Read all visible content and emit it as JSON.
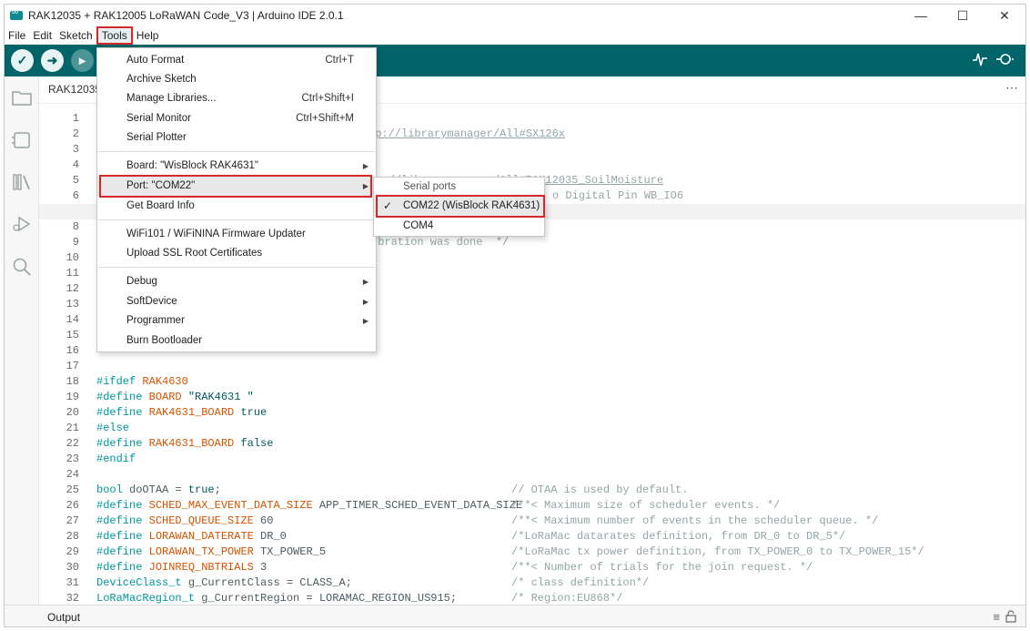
{
  "window": {
    "title": "RAK12035 + RAK12005 LoRaWAN Code_V3 | Arduino IDE 2.0.1",
    "controls": [
      "—",
      "☐",
      "✕"
    ]
  },
  "menubar": [
    "File",
    "Edit",
    "Sketch",
    "Tools",
    "Help"
  ],
  "toolbar": {
    "verify_icon": "check-icon",
    "upload_icon": "arrow-right-icon",
    "debug_icon": "debug-icon",
    "serial_plotter_icon": "plotter-icon",
    "serial_monitor_icon": "monitor-icon"
  },
  "tab": {
    "label": "RAK12035",
    "more": "⋯"
  },
  "tools_menu": {
    "items": [
      {
        "label": "Auto Format",
        "shortcut": "Ctrl+T"
      },
      {
        "label": "Archive Sketch",
        "shortcut": ""
      },
      {
        "label": "Manage Libraries...",
        "shortcut": "Ctrl+Shift+I"
      },
      {
        "label": "Serial Monitor",
        "shortcut": "Ctrl+Shift+M"
      },
      {
        "label": "Serial Plotter",
        "shortcut": ""
      },
      {
        "label": "Board: \"WisBlock RAK4631\"",
        "shortcut": ""
      },
      {
        "label": "Port: \"COM22\"",
        "shortcut": ""
      },
      {
        "label": "Get Board Info",
        "shortcut": ""
      },
      {
        "label": "WiFi101 / WiFiNINA Firmware Updater",
        "shortcut": ""
      },
      {
        "label": "Upload SSL Root Certificates",
        "shortcut": ""
      },
      {
        "label": "Debug",
        "shortcut": ""
      },
      {
        "label": "SoftDevice",
        "shortcut": ""
      },
      {
        "label": "Programmer",
        "shortcut": ""
      },
      {
        "label": "Burn Bootloader",
        "shortcut": ""
      }
    ]
  },
  "port_submenu": {
    "header": "Serial ports",
    "items": [
      {
        "label": "COM22 (WisBlock RAK4631)",
        "check": "✓"
      },
      {
        "label": "COM4",
        "check": ""
      }
    ]
  },
  "editor": {
    "line_numbers": [
      "1",
      "2",
      "3",
      "4",
      "5",
      "6",
      "7",
      "8",
      "9",
      "10",
      "11",
      "12",
      "13",
      "14",
      "15",
      "16",
      "17",
      "18",
      "19",
      "20",
      "21",
      "22",
      "23",
      "24",
      "25",
      "26",
      "27",
      "28",
      "29",
      "30",
      "31",
      "32"
    ],
    "visible_fragments": {
      "l2": "tp://librarymanager/All#SX126x",
      "l5": "tp://librarymanager/All#RAK12035_SoilMoisture",
      "l6": "o Digital Pin WB_IO6",
      "l9": "ibration was done  */"
    },
    "code": {
      "l18a": "#ifdef",
      "l18b": " RAK4630",
      "l19a": "#define",
      "l19b": "BOARD",
      "l19c": "\"RAK4631 \"",
      "l20a": "#define",
      "l20b": "RAK4631_BOARD",
      "l20c": "true",
      "l21": "#else",
      "l22a": "#define",
      "l22b": "RAK4631_BOARD",
      "l22c": "false",
      "l23": "#endif",
      "l25a": "bool",
      "l25b": " doOTAA = ",
      "l25c": "true",
      "l25d": ";",
      "l25cm": "// OTAA is used by default.",
      "l26a": "#define",
      "l26b": "SCHED_MAX_EVENT_DATA_SIZE",
      "l26c": " APP_TIMER_SCHED_EVENT_DATA_SIZE",
      "l26cm": "/**< Maximum size of scheduler events. */",
      "l27a": "#define",
      "l27b": "SCHED_QUEUE_SIZE",
      "l27c": " 60",
      "l27cm": "/**< Maximum number of events in the scheduler queue. */",
      "l28a": "#define",
      "l28b": "LORAWAN_DATERATE",
      "l28c": " DR_0",
      "l28cm": "/*LoRaMac datarates definition, from DR_0 to DR_5*/",
      "l29a": "#define",
      "l29b": "LORAWAN_TX_POWER",
      "l29c": " TX_POWER_5",
      "l29cm": "/*LoRaMac tx power definition, from TX_POWER_0 to TX_POWER_15*/",
      "l30a": "#define",
      "l30b": "JOINREQ_NBTRIALS",
      "l30c": " 3",
      "l30cm": "/**< Number of trials for the join request. */",
      "l31a": "DeviceClass_t",
      "l31b": " g_CurrentClass = CLASS_A;",
      "l31cm": "/* class definition*/",
      "l32a": "LoRaMacRegion_t",
      "l32b": " g_CurrentRegion = LORAMAC_REGION_US915;",
      "l32cm": "/* Region:EU868*/"
    }
  },
  "bottom": {
    "output_label": "Output"
  }
}
